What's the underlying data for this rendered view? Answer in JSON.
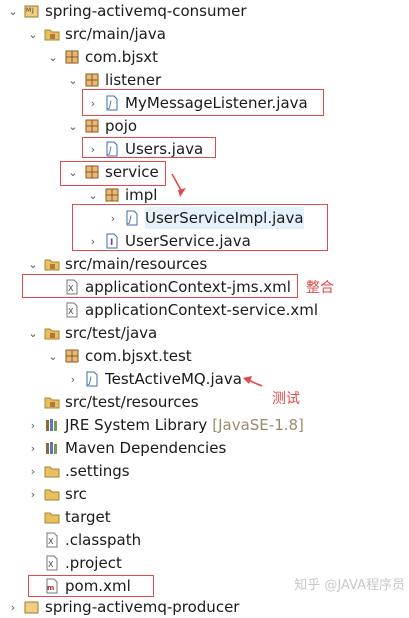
{
  "tree": [
    {
      "label": "spring-activemq-consumer",
      "icon": "maven-project-icon",
      "expanded": true
    },
    {
      "label": "src/main/java",
      "icon": "source-folder-icon",
      "expanded": true
    },
    {
      "label": "com.bjsxt",
      "icon": "package-icon",
      "expanded": true
    },
    {
      "label": "listener",
      "icon": "package-icon",
      "expanded": true
    },
    {
      "label": "MyMessageListener.java",
      "icon": "java-file-icon",
      "expanded": false
    },
    {
      "label": "pojo",
      "icon": "package-icon",
      "expanded": true
    },
    {
      "label": "Users.java",
      "icon": "java-file-icon",
      "expanded": false
    },
    {
      "label": "service",
      "icon": "package-icon",
      "expanded": true
    },
    {
      "label": "impl",
      "icon": "package-icon",
      "expanded": true
    },
    {
      "label": "UserServiceImpl.java",
      "icon": "java-file-icon",
      "expanded": false
    },
    {
      "label": "UserService.java",
      "icon": "java-interface-icon",
      "expanded": false
    },
    {
      "label": "src/main/resources",
      "icon": "source-folder-icon",
      "expanded": true
    },
    {
      "label": "applicationContext-jms.xml",
      "icon": "xml-file-icon"
    },
    {
      "label": "applicationContext-service.xml",
      "icon": "xml-file-icon"
    },
    {
      "label": "src/test/java",
      "icon": "source-folder-icon",
      "expanded": true
    },
    {
      "label": "com.bjsxt.test",
      "icon": "package-icon",
      "expanded": true
    },
    {
      "label": "TestActiveMQ.java",
      "icon": "java-file-icon",
      "expanded": false
    },
    {
      "label": "src/test/resources",
      "icon": "source-folder-icon"
    },
    {
      "label": "JRE System Library",
      "suffix": "[JavaSE-1.8]",
      "icon": "library-icon",
      "expanded": false
    },
    {
      "label": "Maven Dependencies",
      "icon": "library-icon",
      "expanded": false
    },
    {
      "label": ".settings",
      "icon": "folder-icon",
      "expanded": false
    },
    {
      "label": "src",
      "icon": "folder-icon",
      "expanded": false
    },
    {
      "label": "target",
      "icon": "folder-icon"
    },
    {
      "label": ".classpath",
      "icon": "xml-file-icon"
    },
    {
      "label": ".project",
      "icon": "xml-file-icon"
    },
    {
      "label": "pom.xml",
      "icon": "pom-file-icon"
    },
    {
      "label": "spring-activemq-producer",
      "icon": "maven-project-icon"
    }
  ],
  "annotations": {
    "integrate_note": "整合",
    "test_note": "测试"
  },
  "watermark": "知乎 @JAVA程序员",
  "colors": {
    "annotation_red": "#e24a4a",
    "selection": "#e6f2fb",
    "package_brown": "#b0793a",
    "java_blue": "#3b6ea8",
    "folder_yellow": "#e8c060"
  }
}
